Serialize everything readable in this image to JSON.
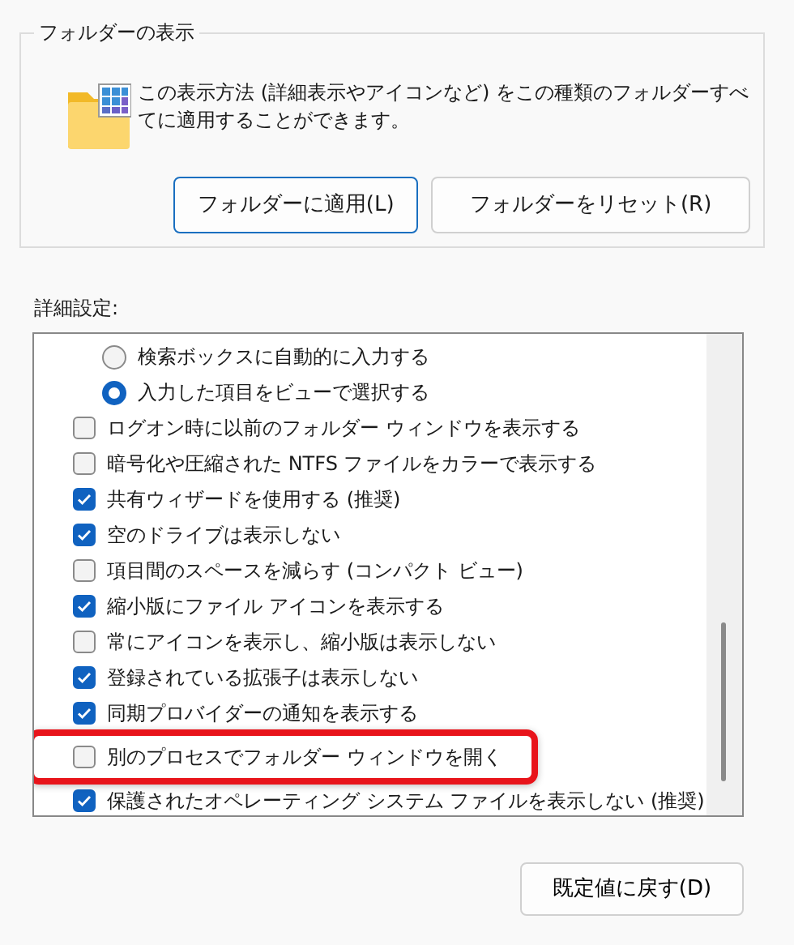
{
  "folder_views": {
    "title": "フォルダーの表示",
    "description": "この表示方法 (詳細表示やアイコンなど) をこの種類のフォルダーすべてに適用することができます。",
    "buttons": [
      {
        "label": "フォルダーに適用(L)",
        "focused": true
      },
      {
        "label": "フォルダーをリセット(R)",
        "focused": false
      }
    ]
  },
  "advanced": {
    "label": "詳細設定:",
    "items": [
      {
        "kind": "radio",
        "label": "検索ボックスに自動的に入力する",
        "selected": false,
        "highlighted": false
      },
      {
        "kind": "radio",
        "label": "入力した項目をビューで選択する",
        "selected": true,
        "highlighted": false
      },
      {
        "kind": "checkbox",
        "label": "ログオン時に以前のフォルダー ウィンドウを表示する",
        "checked": false,
        "highlighted": false
      },
      {
        "kind": "checkbox",
        "label": "暗号化や圧縮された NTFS ファイルをカラーで表示する",
        "checked": false,
        "highlighted": false
      },
      {
        "kind": "checkbox",
        "label": "共有ウィザードを使用する (推奨)",
        "checked": true,
        "highlighted": false
      },
      {
        "kind": "checkbox",
        "label": "空のドライブは表示しない",
        "checked": true,
        "highlighted": false
      },
      {
        "kind": "checkbox",
        "label": "項目間のスペースを減らす (コンパクト ビュー)",
        "checked": false,
        "highlighted": false
      },
      {
        "kind": "checkbox",
        "label": "縮小版にファイル アイコンを表示する",
        "checked": true,
        "highlighted": false
      },
      {
        "kind": "checkbox",
        "label": "常にアイコンを表示し、縮小版は表示しない",
        "checked": false,
        "highlighted": false
      },
      {
        "kind": "checkbox",
        "label": "登録されている拡張子は表示しない",
        "checked": true,
        "highlighted": false
      },
      {
        "kind": "checkbox",
        "label": "同期プロバイダーの通知を表示する",
        "checked": true,
        "highlighted": false
      },
      {
        "kind": "checkbox",
        "label": "別のプロセスでフォルダー ウィンドウを開く",
        "checked": false,
        "highlighted": true
      },
      {
        "kind": "checkbox",
        "label": "保護されたオペレーティング システム ファイルを表示しない (推奨)",
        "checked": true,
        "highlighted": false
      }
    ]
  },
  "restore_button": {
    "label": "既定値に戻す(D)"
  }
}
